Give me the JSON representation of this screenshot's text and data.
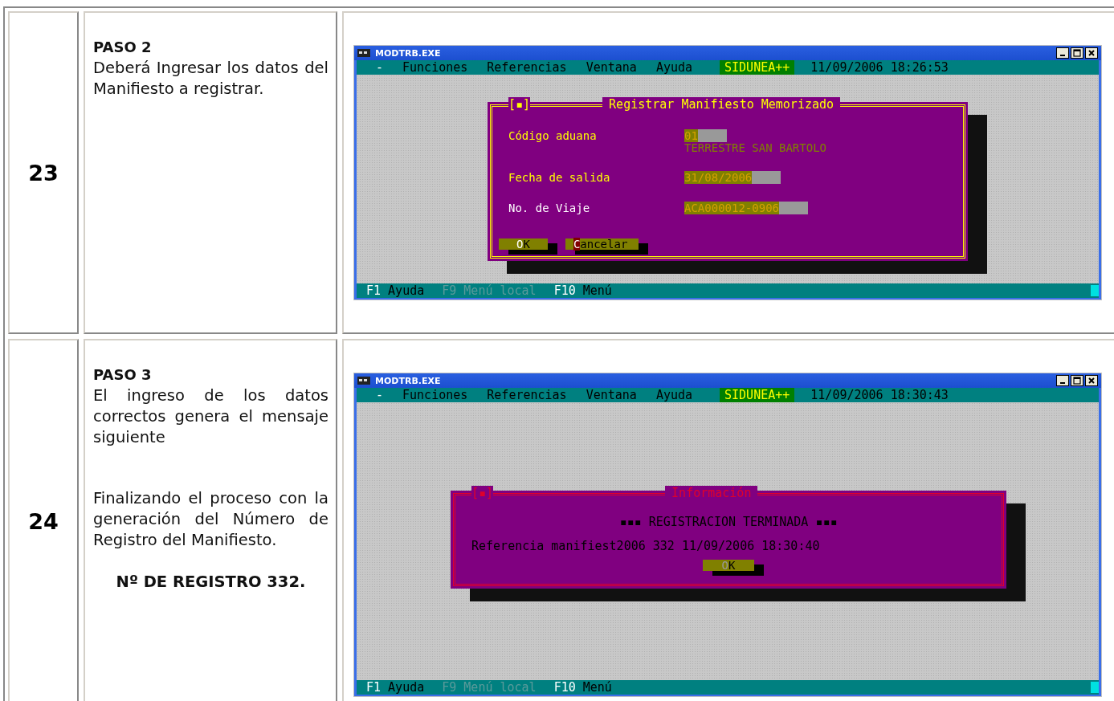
{
  "steps": [
    {
      "number": "23",
      "title": "PASO 2",
      "paragraphs": [
        {
          "kind": "text",
          "text": "Deberá Ingresar los datos del Manifiesto a registrar."
        }
      ],
      "screen": {
        "window_title": "MODTRB.EXE",
        "menu": [
          "-",
          "Funciones",
          "Referencias",
          "Ventana",
          "Ayuda"
        ],
        "brand": "SIDUNEA++",
        "datetime": "11/09/2006 18:26:53",
        "dialog": {
          "kind": "form",
          "title": "Registrar Manifiesto Memorizado",
          "marker": "[▪]",
          "fields": [
            {
              "label": "Código aduana",
              "value": "01",
              "note": "TERRESTRE SAN BARTOLO"
            },
            {
              "label": "Fecha de salida",
              "value": "31/08/2006"
            },
            {
              "label": "No. de Viaje",
              "value": "ACA000012-0906"
            }
          ],
          "buttons": [
            "OK",
            "Cancelar"
          ]
        },
        "status": [
          {
            "key": "F1",
            "label": "Ayuda",
            "disabled": false
          },
          {
            "key": "F9",
            "label": "Menú local",
            "disabled": true
          },
          {
            "key": "F10",
            "label": "Menú",
            "disabled": false
          }
        ]
      }
    },
    {
      "number": "24",
      "title": "PASO  3",
      "paragraphs": [
        {
          "kind": "text",
          "text": "El ingreso de los datos correctos genera el mensaje siguiente"
        },
        {
          "kind": "text",
          "text": "Finalizando el proceso con la generación del Número de Registro del Manifiesto."
        },
        {
          "kind": "emphasis",
          "text": "Nº DE REGISTRO 332."
        }
      ],
      "screen": {
        "window_title": "MODTRB.EXE",
        "menu": [
          "-",
          "Funciones",
          "Referencias",
          "Ventana",
          "Ayuda"
        ],
        "brand": "SIDUNEA++",
        "datetime": "11/09/2006 18:30:43",
        "dialog": {
          "kind": "message",
          "title": "Información",
          "marker": "[▪]",
          "lines": [
            "▪▪▪ REGISTRACION TERMINADA ▪▪▪",
            "Referencia manifiest2006 332 11/09/2006 18:30:40"
          ],
          "buttons": [
            "OK"
          ]
        },
        "status": [
          {
            "key": "F1",
            "label": "Ayuda",
            "disabled": false
          },
          {
            "key": "F9",
            "label": "Menú local",
            "disabled": true
          },
          {
            "key": "F10",
            "label": "Menú",
            "disabled": false
          }
        ]
      }
    }
  ]
}
